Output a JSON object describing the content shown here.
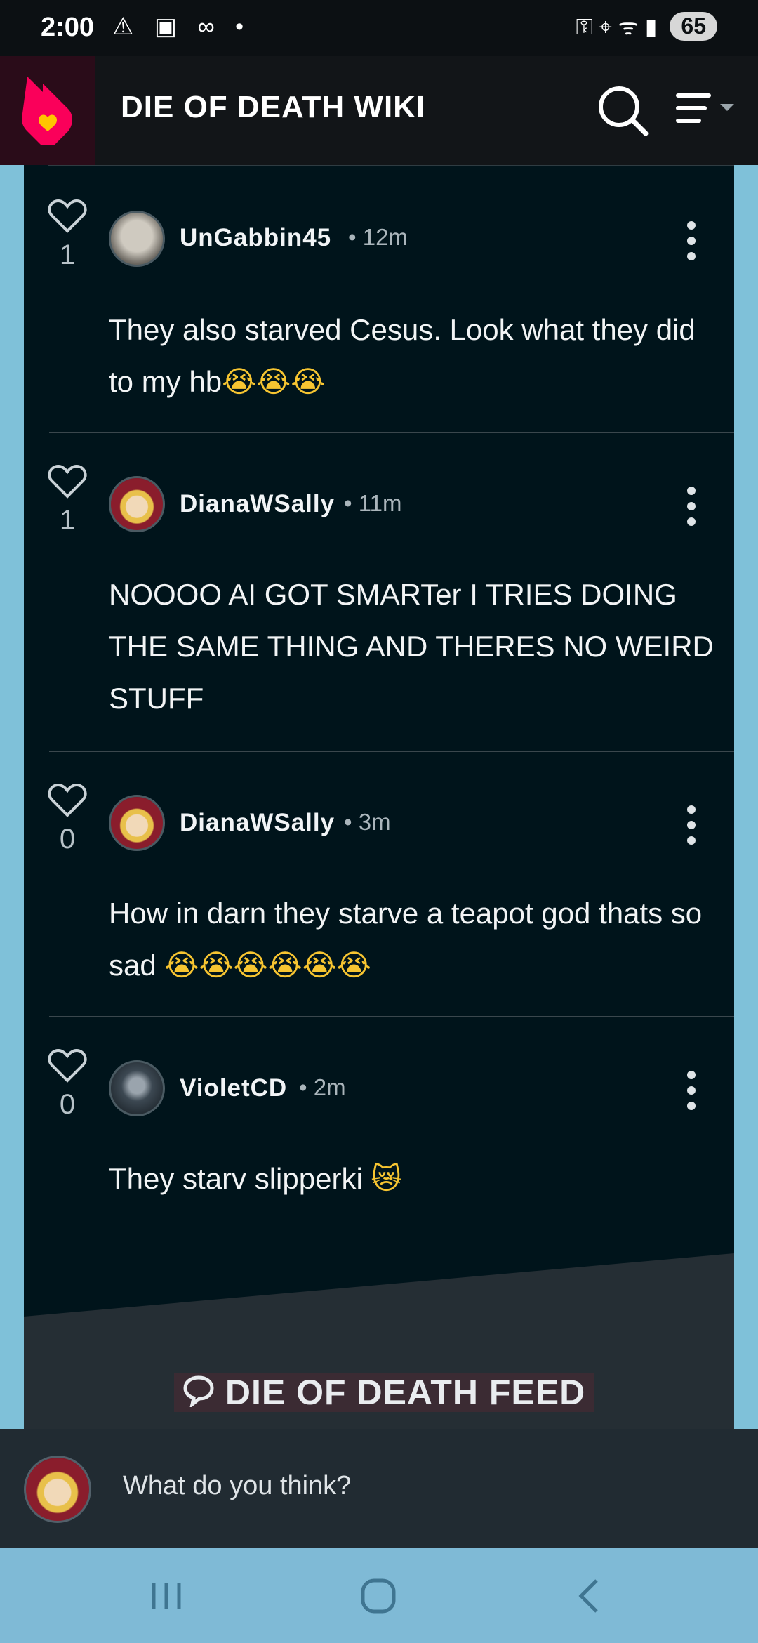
{
  "status_bar": {
    "time": "2:00",
    "left_icons": "⚠ ▣ ∞ •",
    "right_icons": "⚿ ⌖ ᯤ ▮",
    "battery": "65"
  },
  "header": {
    "title": "DIE OF DEATH WIKI",
    "logo_icon": "fandom-heart-icon",
    "search_icon": "search-icon",
    "menu_icon": "menu-icon"
  },
  "comments": [
    {
      "likes": "1",
      "username": "UnGabbin45",
      "time": "12m",
      "text": "They also starved Cesus. Look what they did to my hb",
      "emoji": "😭😭😭",
      "avatar": "seal"
    },
    {
      "likes": "1",
      "username": "DianaWSally",
      "time": "11m",
      "text": "NOOOO AI GOT SMARTer I TRIES DOING THE SAME THING AND THERES NO WEIRD STUFF",
      "emoji": "",
      "avatar": "elf"
    },
    {
      "likes": "0",
      "username": "DianaWSally",
      "time": "3m",
      "text": "How in darn they starve a teapot god thats so sad ",
      "emoji": "😭😭😭😭😭😭",
      "avatar": "elf"
    },
    {
      "likes": "0",
      "username": "VioletCD",
      "time": "2m",
      "text": "They starv slipperki ",
      "emoji": "😿",
      "avatar": "dark"
    }
  ],
  "feed": {
    "title": "DIE OF DEATH FEED",
    "icon": "speech-bubble-icon"
  },
  "comment_input": {
    "placeholder": "What do you think?"
  },
  "colors": {
    "brand": "#fa005a",
    "accent": "#ffc500",
    "panel": "#00141b"
  }
}
